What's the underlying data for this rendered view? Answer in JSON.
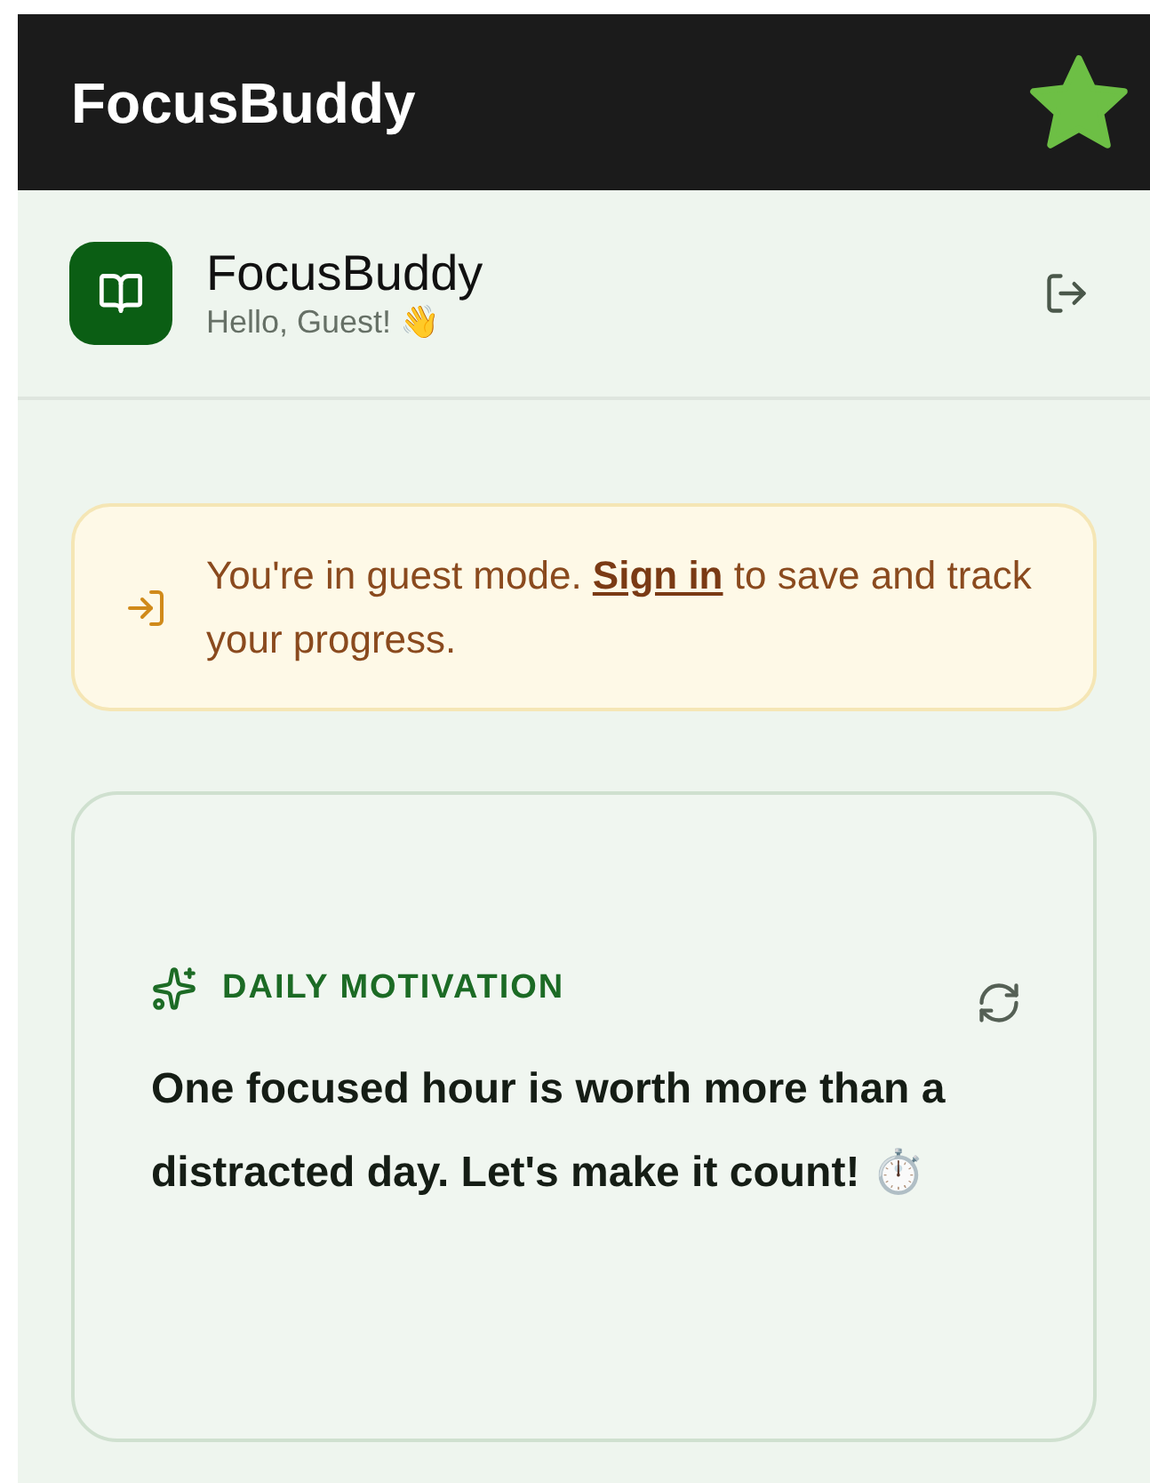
{
  "app_bar": {
    "title": "FocusBuddy"
  },
  "header": {
    "name": "FocusBuddy",
    "greeting": "Hello, Guest! 👋"
  },
  "guest_notice": {
    "before": "You're in guest mode. ",
    "link": "Sign in",
    "after": " to save and track your progress."
  },
  "motivation": {
    "label": "DAILY MOTIVATION",
    "quote": "One focused hour is worth more than a distracted day. Let's make it count! ⏱️"
  }
}
